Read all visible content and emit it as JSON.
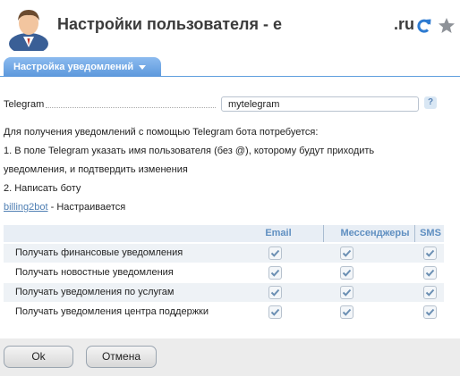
{
  "header": {
    "title": "Настройки пользователя - e                         .ru",
    "refresh_icon": "refresh-icon",
    "favorite_icon": "star-icon"
  },
  "tabs": [
    {
      "label": "Настройка уведомлений",
      "active": true
    }
  ],
  "telegram": {
    "label": "Telegram",
    "value": "mytelegram",
    "help": "?"
  },
  "info": {
    "line1": "Для получения уведомлений с помощью Telegram бота потребуется:",
    "line2": "1. В поле Telegram указать имя пользователя (без @), которому будут приходить",
    "line3": "уведомления, и подтвердить изменения",
    "line4": "2. Написать боту",
    "bot_link": "billing2bot",
    "bot_status": " - Настраивается"
  },
  "notifications": {
    "columns": [
      "Email",
      "Мессенджеры",
      "SMS"
    ],
    "rows": [
      {
        "label": "Получать финансовые уведомления",
        "email": true,
        "messengers": true,
        "sms": true
      },
      {
        "label": "Получать новостные уведомления",
        "email": true,
        "messengers": true,
        "sms": true
      },
      {
        "label": "Получать уведомления по услугам",
        "email": true,
        "messengers": true,
        "sms": true
      },
      {
        "label": "Получать уведомления центра поддержки",
        "email": true,
        "messengers": true,
        "sms": true
      }
    ]
  },
  "buttons": {
    "ok": "Ok",
    "cancel": "Отмена"
  },
  "colors": {
    "accent": "#5c98dc",
    "check": "#6b8fb3"
  }
}
